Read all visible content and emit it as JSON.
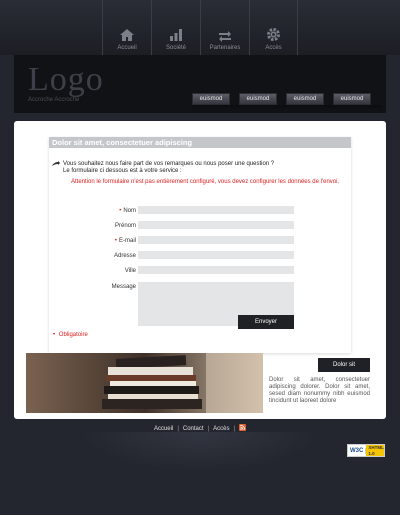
{
  "nav": {
    "items": [
      {
        "label": "Accueil",
        "icon": "home-icon"
      },
      {
        "label": "Société",
        "icon": "chart-icon"
      },
      {
        "label": "Partenaires",
        "icon": "arrows-icon"
      },
      {
        "label": "Accès",
        "icon": "gear-icon"
      }
    ]
  },
  "header": {
    "logo": "Logo",
    "slogan": "Accroche Accroche",
    "tabs": [
      "euismod",
      "euismod",
      "euismod",
      "euismod"
    ]
  },
  "form": {
    "title": "Dolor sit amet, consectetuer adipiscing",
    "intro_line1": "Vous souhaitez nous faire part de vos remarques ou nous poser une question ?",
    "intro_line2": "Le formulaire ci dessous est à votre service :",
    "warning": "Attention le formulaire n'est pas entièrement configuré, vous devez configurer les données de l'envoi.",
    "fields": {
      "nom": "Nom",
      "prenom": "Prénom",
      "email": "E-mail",
      "adresse": "Adresse",
      "ville": "Ville",
      "message": "Message"
    },
    "submit_label": "Envoyer",
    "required_note": "Obligatoire"
  },
  "promo": {
    "button_label": "Dolor sit",
    "text": "Dolor sit amet, consectetuer adipiscing dolorer. Dolor sit amet, sesed diam nonummy nibh euismod tincidunt ut laoreet dolore"
  },
  "footer": {
    "links": [
      "Accueil",
      "Contact",
      "Accès"
    ]
  },
  "badge": {
    "left": "W3C",
    "right": "XHTML 1.0"
  },
  "colors": {
    "background": "#23262e",
    "accent": "#e02020",
    "button": "#1f2126"
  }
}
